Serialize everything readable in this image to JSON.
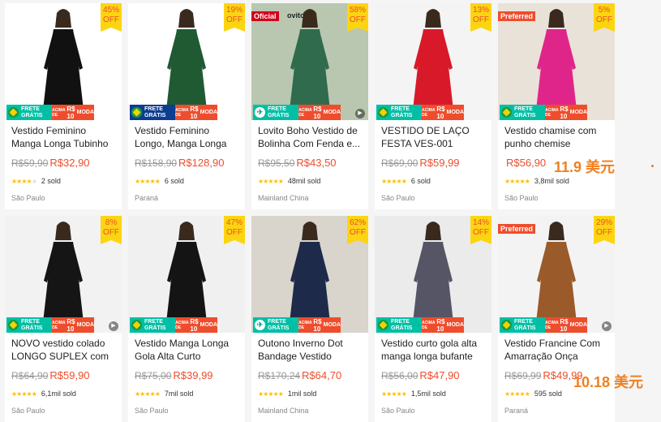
{
  "products": [
    {
      "title": "Vestido Feminino Manga Longa Tubinho",
      "orig": "R$59,90",
      "price": "R$32,90",
      "sold": "2 sold",
      "loc": "São Paulo",
      "discount_pct": "45%",
      "discount_off": "OFF",
      "tag": "",
      "play": false,
      "banner": "br",
      "stars": 4,
      "bg": "#ffffff",
      "dress": "#111111"
    },
    {
      "title": "Vestido Feminino Longo, Manga Longa 055",
      "orig": "R$158,90",
      "price": "R$128,90",
      "sold": "6 sold",
      "loc": "Paraná",
      "discount_pct": "19%",
      "discount_off": "OFF",
      "tag": "",
      "play": false,
      "banner": "br-blue",
      "stars": 5,
      "bg": "#ffffff",
      "dress": "#1f5a32"
    },
    {
      "title": "Lovito Boho Vestido de Bolinha Com Fenda e...",
      "orig": "R$95,50",
      "price": "R$43,50",
      "sold": "48mil sold",
      "loc": "Mainland China",
      "discount_pct": "58%",
      "discount_off": "OFF",
      "tag": "Oficial",
      "tag_text": "ovito",
      "play": true,
      "banner": "plane",
      "stars": 5,
      "bg": "#b9c7b0",
      "dress": "#2f6b4c"
    },
    {
      "title": "VESTIDO DE LAÇO FESTA VES-001",
      "orig": "R$69,00",
      "price": "R$59,99",
      "sold": "6 sold",
      "loc": "São Paulo",
      "discount_pct": "13%",
      "discount_off": "OFF",
      "tag": "",
      "play": false,
      "banner": "br",
      "stars": 5,
      "bg": "#f4f4f4",
      "dress": "#d8192a"
    },
    {
      "title": "Vestido chamise com punho chemise",
      "orig": "",
      "price": "R$56,90",
      "sold": "3,8mil sold",
      "loc": "São Paulo",
      "discount_pct": "5%",
      "discount_off": "OFF",
      "tag": "Preferred",
      "play": false,
      "banner": "br",
      "stars": 5,
      "bg": "#e9e2d8",
      "dress": "#e0258a"
    },
    {
      "title": "NOVO vestido colado LONGO SUPLEX com fend...",
      "orig": "R$64,90",
      "price": "R$59,90",
      "sold": "6,1mil sold",
      "loc": "São Paulo",
      "discount_pct": "8%",
      "discount_off": "OFF",
      "tag": "",
      "play": true,
      "banner": "br",
      "stars": 5,
      "bg": "#f2f2f2",
      "dress": "#151515"
    },
    {
      "title": "Vestido Manga Longa Gola Alta Curto Tubinho...",
      "orig": "R$75,00",
      "price": "R$39,99",
      "sold": "7mil sold",
      "loc": "São Paulo",
      "discount_pct": "47%",
      "discount_off": "OFF",
      "tag": "",
      "play": false,
      "banner": "br",
      "stars": 5,
      "bg": "#f0f0f0",
      "dress": "#141414"
    },
    {
      "title": "Outono Inverno Dot Bandage Vestido Mulhere...",
      "orig": "R$170,24",
      "price": "R$64,70",
      "sold": "1mil sold",
      "loc": "Mainland China",
      "discount_pct": "62%",
      "discount_off": "OFF",
      "tag": "",
      "play": false,
      "banner": "plane",
      "stars": 5,
      "bg": "#d9d4cc",
      "dress": "#1e2a4a"
    },
    {
      "title": "Vestido curto gola alta manga longa bufante pied...",
      "orig": "R$56,00",
      "price": "R$47,90",
      "sold": "1,5mil sold",
      "loc": "São Paulo",
      "discount_pct": "14%",
      "discount_off": "OFF",
      "tag": "",
      "play": false,
      "banner": "br",
      "stars": 5,
      "bg": "#ebebeb",
      "dress": "#555566"
    },
    {
      "title": "Vestido Francine Com Amarração Onça Grande",
      "orig": "R$69,99",
      "price": "R$49,99",
      "sold": "595 sold",
      "loc": "Paraná",
      "discount_pct": "29%",
      "discount_off": "OFF",
      "tag": "Preferred",
      "play": true,
      "banner": "br",
      "stars": 5,
      "bg": "#f3f3f3",
      "dress": "#9a5a2a"
    }
  ],
  "banner": {
    "frete1": "FRETE",
    "frete2": "GRÁTIS",
    "acima": "ACIMA DE",
    "valor": "R$ 10",
    "moda": "MODA"
  },
  "annotations": {
    "a1": "11.9 美元",
    "a2": "10.18 美元"
  },
  "colors": {
    "accent": "#ee4d2d",
    "star": "#ffbf00",
    "discount": "#fcd511",
    "frete": "#00bfa5"
  }
}
